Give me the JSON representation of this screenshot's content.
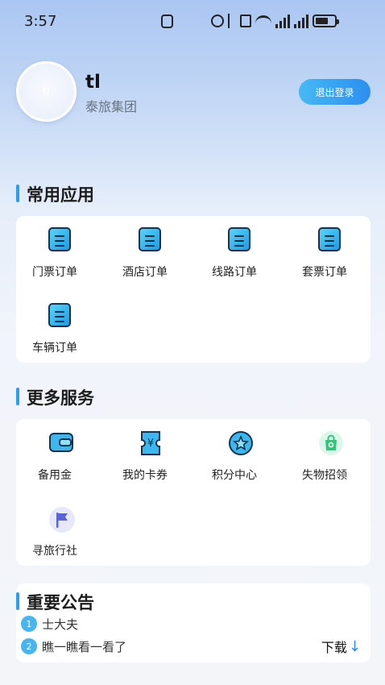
{
  "status_bar": {
    "time": "3:57"
  },
  "profile": {
    "avatar_text": "tl",
    "name": "tl",
    "org": "泰旅集团",
    "logout_label": "退出登录"
  },
  "common_apps": {
    "title": "常用应用",
    "items": [
      {
        "label": "门票订单",
        "icon": "ticket-order-icon"
      },
      {
        "label": "酒店订单",
        "icon": "hotel-order-icon"
      },
      {
        "label": "线路订单",
        "icon": "route-order-icon"
      },
      {
        "label": "套票订单",
        "icon": "package-order-icon"
      },
      {
        "label": "车辆订单",
        "icon": "vehicle-order-icon"
      }
    ]
  },
  "more_services": {
    "title": "更多服务",
    "items": [
      {
        "label": "备用金",
        "icon": "wallet-icon"
      },
      {
        "label": "我的卡券",
        "icon": "coupon-icon"
      },
      {
        "label": "积分中心",
        "icon": "points-star-icon"
      },
      {
        "label": "失物招领",
        "icon": "lost-found-bag-icon"
      },
      {
        "label": "寻旅行社",
        "icon": "flag-icon"
      }
    ]
  },
  "notices": {
    "title": "重要公告",
    "items": [
      {
        "num": "1",
        "text": "士大夫"
      },
      {
        "num": "2",
        "text": "瞧一瞧看一看了"
      }
    ],
    "download_label": "下载",
    "download_icon": "arrow-down-icon"
  },
  "colors": {
    "accent": "#2a9df4",
    "button_start": "#46b9f5",
    "button_end": "#2b8ff0"
  }
}
